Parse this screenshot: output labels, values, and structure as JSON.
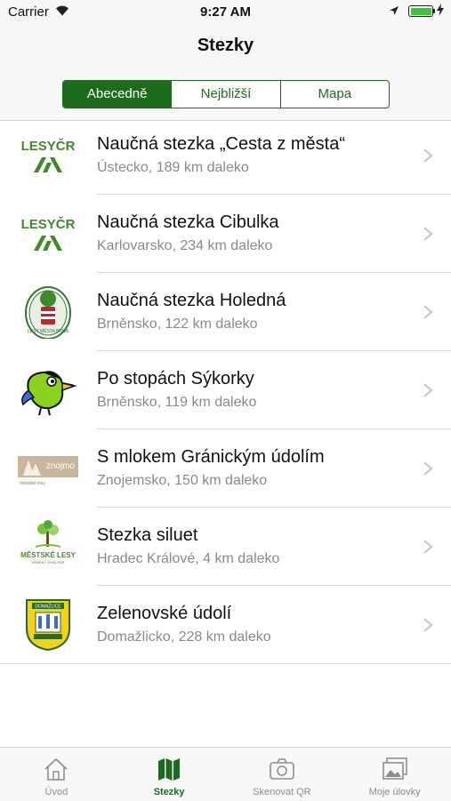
{
  "status_bar": {
    "carrier": "Carrier",
    "time": "9:27 AM",
    "battery_level": 1.0
  },
  "nav": {
    "title": "Stezky"
  },
  "segments": [
    {
      "label": "Abecedně",
      "selected": true
    },
    {
      "label": "Nejbližší",
      "selected": false
    },
    {
      "label": "Mapa",
      "selected": false
    }
  ],
  "trails": [
    {
      "name": "Naučná stezka „Cesta z města“",
      "meta": "Ústecko, 189 km daleko",
      "logo": "lesy-cr-logo"
    },
    {
      "name": "Naučná stezka Cibulka",
      "meta": "Karlovarsko, 234 km daleko",
      "logo": "lesy-cr-logo"
    },
    {
      "name": "Naučná stezka Holedná",
      "meta": "Brněnsko, 122 km daleko",
      "logo": "lesy-mesta-brna-logo"
    },
    {
      "name": "Po stopách Sýkorky",
      "meta": "Brněnsko, 119 km daleko",
      "logo": "sykorka-bird-logo"
    },
    {
      "name": "S mlokem Gránickým údolím",
      "meta": "Znojemsko, 150 km daleko",
      "logo": "znojmo-lesy-logo"
    },
    {
      "name": "Stezka siluet",
      "meta": "Hradec Králové, 4 km daleko",
      "logo": "mestske-lesy-hk-logo"
    },
    {
      "name": "Zelenovské údolí",
      "meta": "Domažlicko, 228 km daleko",
      "logo": "domazlice-logo"
    }
  ],
  "logo_text": {
    "lesy_cr": "LESYČR",
    "znojmo": "znojmo",
    "znojmo_sub": "městské lesy",
    "mestske_lesy": "MĚSTSKÉ LESY",
    "mestske_lesy_sub": "HRADEC KRÁLOVÉ",
    "brno_arc": "LESY MĚSTA BRNA",
    "domazlice_top": "DOMAŽLICE"
  },
  "tabs": [
    {
      "label": "Úvod",
      "icon": "home-icon",
      "selected": false
    },
    {
      "label": "Stezky",
      "icon": "map-icon",
      "selected": true
    },
    {
      "label": "Skenovat QR",
      "icon": "camera-icon",
      "selected": false
    },
    {
      "label": "Moje úlovky",
      "icon": "photos-icon",
      "selected": false
    }
  ],
  "colors": {
    "accent": "#1e6b1e",
    "secondary_text": "#8a8a8a",
    "bar_background": "#f7f7f7"
  }
}
